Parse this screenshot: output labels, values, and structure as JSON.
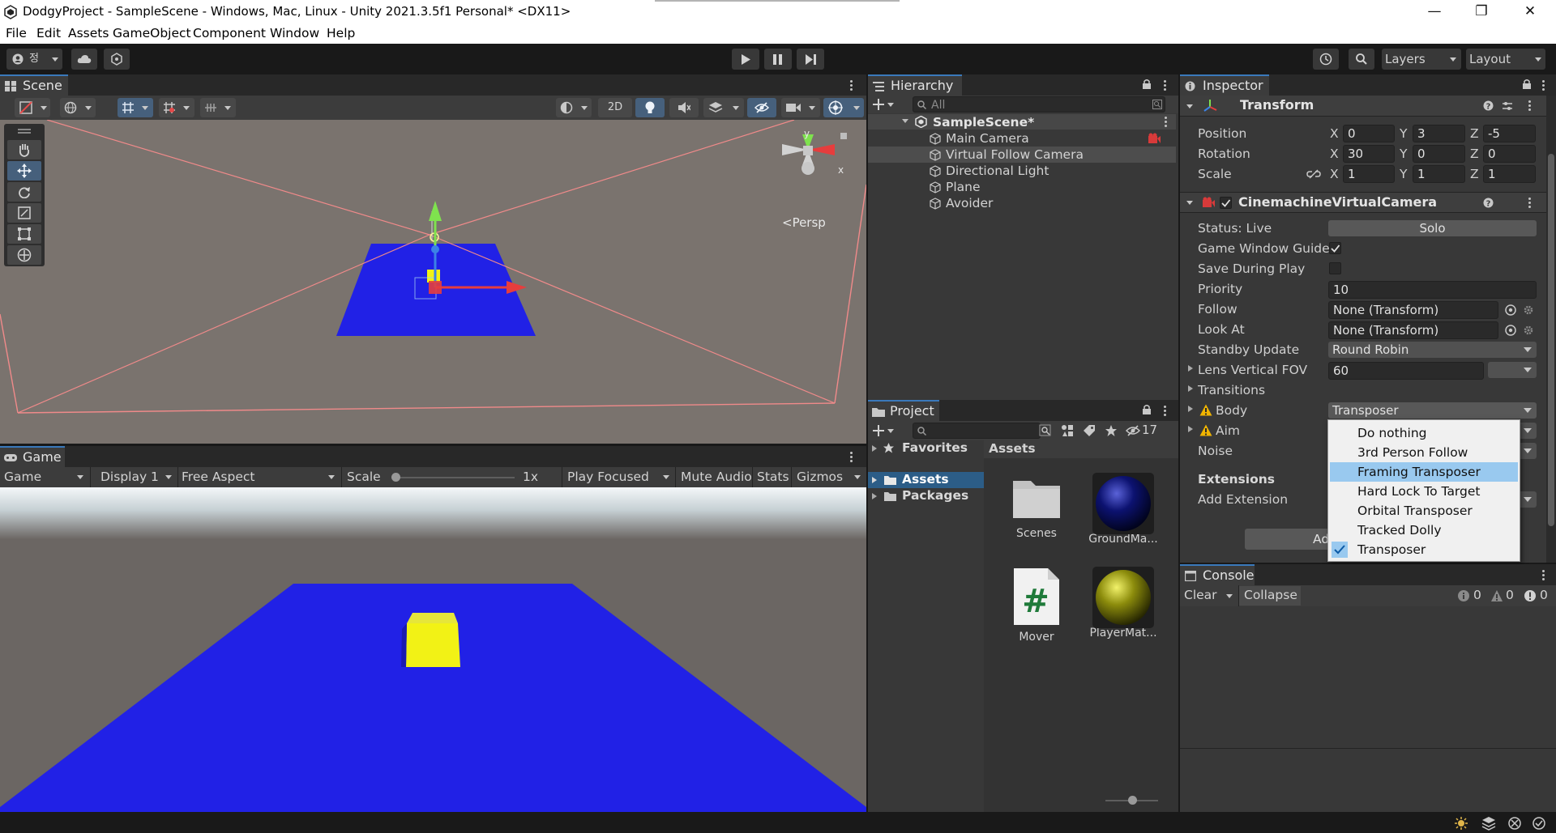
{
  "window": {
    "title": "DodgyProject - SampleScene - Windows, Mac, Linux - Unity 2021.3.5f1 Personal* <DX11>",
    "minimize_glyph": "—",
    "maximize_glyph": "❐",
    "close_glyph": "✕"
  },
  "menu": [
    "File",
    "Edit",
    "Assets",
    "GameObject",
    "Component",
    "Window",
    "Help"
  ],
  "toolbar": {
    "account_label": "정",
    "layers_label": "Layers",
    "layout_label": "Layout"
  },
  "scene_view": {
    "tab_label": "Scene",
    "btn_2d": "2D",
    "persp_label": "<Persp",
    "gizmo_y": "y",
    "gizmo_x": "x"
  },
  "game_view": {
    "tab_label": "Game",
    "game_dropdown": "Game",
    "display_dropdown": "Display 1",
    "aspect_dropdown": "Free Aspect",
    "scale_label": "Scale",
    "scale_value": "1x",
    "scale_level": 0.0,
    "play_focused": "Play Focused",
    "mute_audio": "Mute Audio",
    "stats": "Stats",
    "gizmos": "Gizmos"
  },
  "hierarchy": {
    "tab_label": "Hierarchy",
    "search_placeholder": "All",
    "scene_name": "SampleScene*",
    "items": [
      "Main Camera",
      "Virtual Follow Camera",
      "Directional Light",
      "Plane",
      "Avoider"
    ]
  },
  "project": {
    "tab_label": "Project",
    "hidden_count": "17",
    "favorites_label": "Favorites",
    "tree": [
      "Assets",
      "Packages"
    ],
    "breadcrumb": "Assets",
    "assets": [
      {
        "name": "Scenes",
        "icon": "folder-icon"
      },
      {
        "name": "GroundMa...",
        "icon": "material-sphere-icon",
        "color": "#0c1270"
      },
      {
        "name": "Mover",
        "icon": "csharp-script-icon"
      },
      {
        "name": "PlayerMat...",
        "icon": "material-sphere-icon",
        "color": "#8c8c0c"
      }
    ]
  },
  "inspector": {
    "tab_label": "Inspector",
    "transform": {
      "title": "Transform",
      "position_label": "Position",
      "rotation_label": "Rotation",
      "scale_label": "Scale",
      "axis_x": "X",
      "axis_y": "Y",
      "axis_z": "Z",
      "position": [
        "0",
        "3",
        "-5"
      ],
      "rotation": [
        "30",
        "0",
        "0"
      ],
      "scale": [
        "1",
        "1",
        "1"
      ]
    },
    "vcam": {
      "title": "CinemachineVirtualCamera",
      "status_label": "Status: Live",
      "solo_button": "Solo",
      "guides_label": "Game Window Guides",
      "guides_checked": true,
      "save_label": "Save During Play",
      "save_checked": false,
      "priority_label": "Priority",
      "priority_value": "10",
      "follow_label": "Follow",
      "follow_value": "None (Transform)",
      "lookat_label": "Look At",
      "lookat_value": "None (Transform)",
      "standby_label": "Standby Update",
      "standby_value": "Round Robin",
      "fov_label": "Lens Vertical FOV",
      "fov_value": "60",
      "transitions_label": "Transitions",
      "body_label": "Body",
      "body_value": "Transposer",
      "aim_label": "Aim",
      "noise_label": "Noise",
      "extensions_label": "Extensions",
      "add_extension_label": "Add Extension",
      "add_component_partial": "Ad"
    },
    "body_options": [
      "Do nothing",
      "3rd Person Follow",
      "Framing Transposer",
      "Hard Lock To Target",
      "Orbital Transposer",
      "Tracked Dolly",
      "Transposer"
    ],
    "highlighted_option": "Framing Transposer",
    "checked_option": "Transposer"
  },
  "console": {
    "tab_label": "Console",
    "clear": "Clear",
    "collapse": "Collapse",
    "log_count": "0",
    "warn_count": "0",
    "error_count": "0"
  },
  "colors": {
    "accent": "#3a79bb",
    "plane_blue": "#2121e6",
    "cube_yellow": "#f2f215",
    "dropdown_highlight": "#99c9ef"
  }
}
